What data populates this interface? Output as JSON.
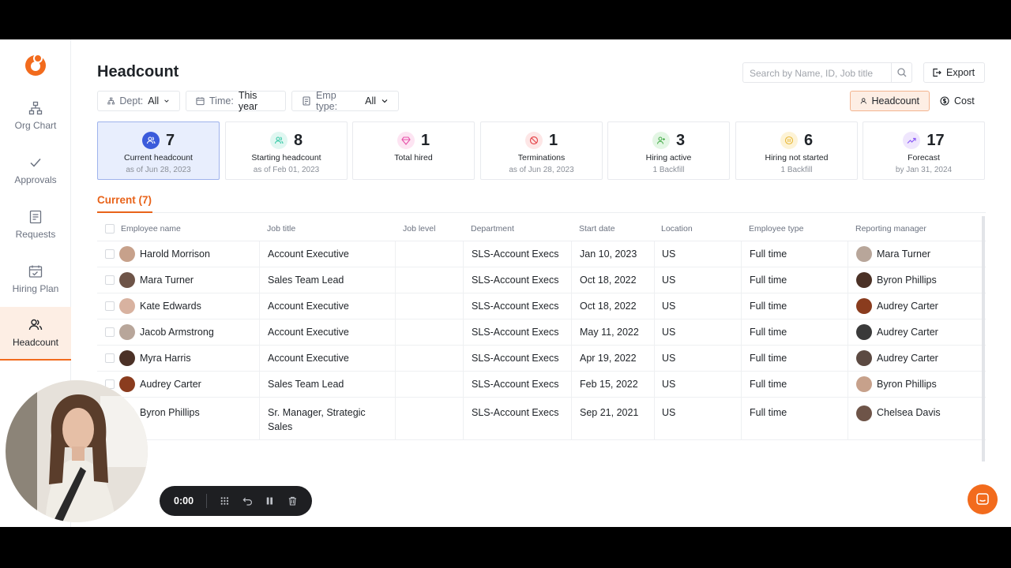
{
  "sidebar": {
    "items": [
      {
        "label": "Org Chart",
        "icon": "org-chart-icon"
      },
      {
        "label": "Approvals",
        "icon": "check-icon"
      },
      {
        "label": "Requests",
        "icon": "requests-icon"
      },
      {
        "label": "Hiring Plan",
        "icon": "calendar-icon"
      },
      {
        "label": "Headcount",
        "icon": "people-icon",
        "active": true
      }
    ]
  },
  "header": {
    "title": "Headcount",
    "search_placeholder": "Search by Name, ID, Job title",
    "export_label": "Export"
  },
  "filters": {
    "dept": {
      "label": "Dept:",
      "value": "All"
    },
    "time": {
      "label": "Time:",
      "value": "This year"
    },
    "emp_type": {
      "label": "Emp type:",
      "value": "All"
    }
  },
  "view_toggle": {
    "headcount": "Headcount",
    "cost": "Cost",
    "selected": "Headcount"
  },
  "cards": [
    {
      "number": "7",
      "label": "Current headcount",
      "sub": "as of Jun 28, 2023",
      "color": "#3b5bdb"
    },
    {
      "number": "8",
      "label": "Starting headcount",
      "sub": "as of Feb 01, 2023",
      "color": "#38c9a8"
    },
    {
      "number": "1",
      "label": "Total hired",
      "sub": "",
      "color": "#e64fa8"
    },
    {
      "number": "1",
      "label": "Terminations",
      "sub": "as of Jun 28, 2023",
      "color": "#e5484d"
    },
    {
      "number": "3",
      "label": "Hiring active",
      "sub": "1 Backfill",
      "color": "#4caf50"
    },
    {
      "number": "6",
      "label": "Hiring not started",
      "sub": "1 Backfill",
      "color": "#e8b93b"
    },
    {
      "number": "17",
      "label": "Forecast",
      "sub": "by Jan 31, 2024",
      "color": "#8b5cf6"
    }
  ],
  "section": {
    "title": "Current (7)"
  },
  "table": {
    "headers": [
      "Employee name",
      "Job title",
      "Job level",
      "Department",
      "Start date",
      "Location",
      "Employee type",
      "Reporting manager"
    ],
    "rows": [
      {
        "name": "Harold Morrison",
        "job": "Account Executive",
        "level": "",
        "dept": "SLS-Account Execs",
        "start": "Jan 10, 2023",
        "loc": "US",
        "type": "Full time",
        "manager": "Mara Turner"
      },
      {
        "name": "Mara Turner",
        "job": "Sales Team Lead",
        "level": "",
        "dept": "SLS-Account Execs",
        "start": "Oct 18, 2022",
        "loc": "US",
        "type": "Full time",
        "manager": "Byron Phillips"
      },
      {
        "name": "Kate Edwards",
        "job": "Account Executive",
        "level": "",
        "dept": "SLS-Account Execs",
        "start": "Oct 18, 2022",
        "loc": "US",
        "type": "Full time",
        "manager": "Audrey Carter"
      },
      {
        "name": "Jacob Armstrong",
        "job": "Account Executive",
        "level": "",
        "dept": "SLS-Account Execs",
        "start": "May 11, 2022",
        "loc": "US",
        "type": "Full time",
        "manager": "Audrey Carter"
      },
      {
        "name": "Myra Harris",
        "job": "Account Executive",
        "level": "",
        "dept": "SLS-Account Execs",
        "start": "Apr 19, 2022",
        "loc": "US",
        "type": "Full time",
        "manager": "Audrey Carter"
      },
      {
        "name": "Audrey Carter",
        "job": "Sales Team Lead",
        "level": "",
        "dept": "SLS-Account Execs",
        "start": "Feb 15, 2022",
        "loc": "US",
        "type": "Full time",
        "manager": "Byron Phillips"
      },
      {
        "name": "Byron Phillips",
        "job": "Sr. Manager, Strategic Sales",
        "level": "",
        "dept": "SLS-Account Execs",
        "start": "Sep 21, 2021",
        "loc": "US",
        "type": "Full time",
        "manager": "Chelsea Davis"
      }
    ]
  },
  "recorder": {
    "time": "0:00"
  },
  "colors": {
    "accent": "#f26b1d",
    "selected_card": "#e8eefd"
  }
}
